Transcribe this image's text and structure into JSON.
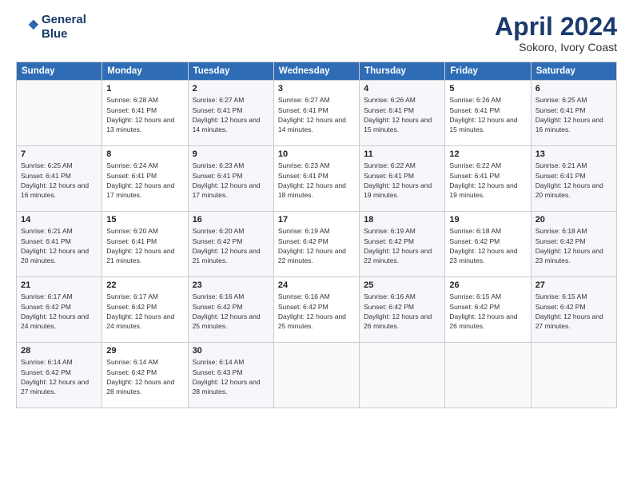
{
  "logo": {
    "line1": "General",
    "line2": "Blue"
  },
  "title": "April 2024",
  "subtitle": "Sokoro, Ivory Coast",
  "weekdays": [
    "Sunday",
    "Monday",
    "Tuesday",
    "Wednesday",
    "Thursday",
    "Friday",
    "Saturday"
  ],
  "weeks": [
    [
      {
        "day": "",
        "sunrise": "",
        "sunset": "",
        "daylight": ""
      },
      {
        "day": "1",
        "sunrise": "Sunrise: 6:28 AM",
        "sunset": "Sunset: 6:41 PM",
        "daylight": "Daylight: 12 hours and 13 minutes."
      },
      {
        "day": "2",
        "sunrise": "Sunrise: 6:27 AM",
        "sunset": "Sunset: 6:41 PM",
        "daylight": "Daylight: 12 hours and 14 minutes."
      },
      {
        "day": "3",
        "sunrise": "Sunrise: 6:27 AM",
        "sunset": "Sunset: 6:41 PM",
        "daylight": "Daylight: 12 hours and 14 minutes."
      },
      {
        "day": "4",
        "sunrise": "Sunrise: 6:26 AM",
        "sunset": "Sunset: 6:41 PM",
        "daylight": "Daylight: 12 hours and 15 minutes."
      },
      {
        "day": "5",
        "sunrise": "Sunrise: 6:26 AM",
        "sunset": "Sunset: 6:41 PM",
        "daylight": "Daylight: 12 hours and 15 minutes."
      },
      {
        "day": "6",
        "sunrise": "Sunrise: 6:25 AM",
        "sunset": "Sunset: 6:41 PM",
        "daylight": "Daylight: 12 hours and 16 minutes."
      }
    ],
    [
      {
        "day": "7",
        "sunrise": "Sunrise: 6:25 AM",
        "sunset": "Sunset: 6:41 PM",
        "daylight": "Daylight: 12 hours and 16 minutes."
      },
      {
        "day": "8",
        "sunrise": "Sunrise: 6:24 AM",
        "sunset": "Sunset: 6:41 PM",
        "daylight": "Daylight: 12 hours and 17 minutes."
      },
      {
        "day": "9",
        "sunrise": "Sunrise: 6:23 AM",
        "sunset": "Sunset: 6:41 PM",
        "daylight": "Daylight: 12 hours and 17 minutes."
      },
      {
        "day": "10",
        "sunrise": "Sunrise: 6:23 AM",
        "sunset": "Sunset: 6:41 PM",
        "daylight": "Daylight: 12 hours and 18 minutes."
      },
      {
        "day": "11",
        "sunrise": "Sunrise: 6:22 AM",
        "sunset": "Sunset: 6:41 PM",
        "daylight": "Daylight: 12 hours and 19 minutes."
      },
      {
        "day": "12",
        "sunrise": "Sunrise: 6:22 AM",
        "sunset": "Sunset: 6:41 PM",
        "daylight": "Daylight: 12 hours and 19 minutes."
      },
      {
        "day": "13",
        "sunrise": "Sunrise: 6:21 AM",
        "sunset": "Sunset: 6:41 PM",
        "daylight": "Daylight: 12 hours and 20 minutes."
      }
    ],
    [
      {
        "day": "14",
        "sunrise": "Sunrise: 6:21 AM",
        "sunset": "Sunset: 6:41 PM",
        "daylight": "Daylight: 12 hours and 20 minutes."
      },
      {
        "day": "15",
        "sunrise": "Sunrise: 6:20 AM",
        "sunset": "Sunset: 6:41 PM",
        "daylight": "Daylight: 12 hours and 21 minutes."
      },
      {
        "day": "16",
        "sunrise": "Sunrise: 6:20 AM",
        "sunset": "Sunset: 6:42 PM",
        "daylight": "Daylight: 12 hours and 21 minutes."
      },
      {
        "day": "17",
        "sunrise": "Sunrise: 6:19 AM",
        "sunset": "Sunset: 6:42 PM",
        "daylight": "Daylight: 12 hours and 22 minutes."
      },
      {
        "day": "18",
        "sunrise": "Sunrise: 6:19 AM",
        "sunset": "Sunset: 6:42 PM",
        "daylight": "Daylight: 12 hours and 22 minutes."
      },
      {
        "day": "19",
        "sunrise": "Sunrise: 6:18 AM",
        "sunset": "Sunset: 6:42 PM",
        "daylight": "Daylight: 12 hours and 23 minutes."
      },
      {
        "day": "20",
        "sunrise": "Sunrise: 6:18 AM",
        "sunset": "Sunset: 6:42 PM",
        "daylight": "Daylight: 12 hours and 23 minutes."
      }
    ],
    [
      {
        "day": "21",
        "sunrise": "Sunrise: 6:17 AM",
        "sunset": "Sunset: 6:42 PM",
        "daylight": "Daylight: 12 hours and 24 minutes."
      },
      {
        "day": "22",
        "sunrise": "Sunrise: 6:17 AM",
        "sunset": "Sunset: 6:42 PM",
        "daylight": "Daylight: 12 hours and 24 minutes."
      },
      {
        "day": "23",
        "sunrise": "Sunrise: 6:16 AM",
        "sunset": "Sunset: 6:42 PM",
        "daylight": "Daylight: 12 hours and 25 minutes."
      },
      {
        "day": "24",
        "sunrise": "Sunrise: 6:16 AM",
        "sunset": "Sunset: 6:42 PM",
        "daylight": "Daylight: 12 hours and 25 minutes."
      },
      {
        "day": "25",
        "sunrise": "Sunrise: 6:16 AM",
        "sunset": "Sunset: 6:42 PM",
        "daylight": "Daylight: 12 hours and 26 minutes."
      },
      {
        "day": "26",
        "sunrise": "Sunrise: 6:15 AM",
        "sunset": "Sunset: 6:42 PM",
        "daylight": "Daylight: 12 hours and 26 minutes."
      },
      {
        "day": "27",
        "sunrise": "Sunrise: 6:15 AM",
        "sunset": "Sunset: 6:42 PM",
        "daylight": "Daylight: 12 hours and 27 minutes."
      }
    ],
    [
      {
        "day": "28",
        "sunrise": "Sunrise: 6:14 AM",
        "sunset": "Sunset: 6:42 PM",
        "daylight": "Daylight: 12 hours and 27 minutes."
      },
      {
        "day": "29",
        "sunrise": "Sunrise: 6:14 AM",
        "sunset": "Sunset: 6:42 PM",
        "daylight": "Daylight: 12 hours and 28 minutes."
      },
      {
        "day": "30",
        "sunrise": "Sunrise: 6:14 AM",
        "sunset": "Sunset: 6:43 PM",
        "daylight": "Daylight: 12 hours and 28 minutes."
      },
      {
        "day": "",
        "sunrise": "",
        "sunset": "",
        "daylight": ""
      },
      {
        "day": "",
        "sunrise": "",
        "sunset": "",
        "daylight": ""
      },
      {
        "day": "",
        "sunrise": "",
        "sunset": "",
        "daylight": ""
      },
      {
        "day": "",
        "sunrise": "",
        "sunset": "",
        "daylight": ""
      }
    ]
  ]
}
